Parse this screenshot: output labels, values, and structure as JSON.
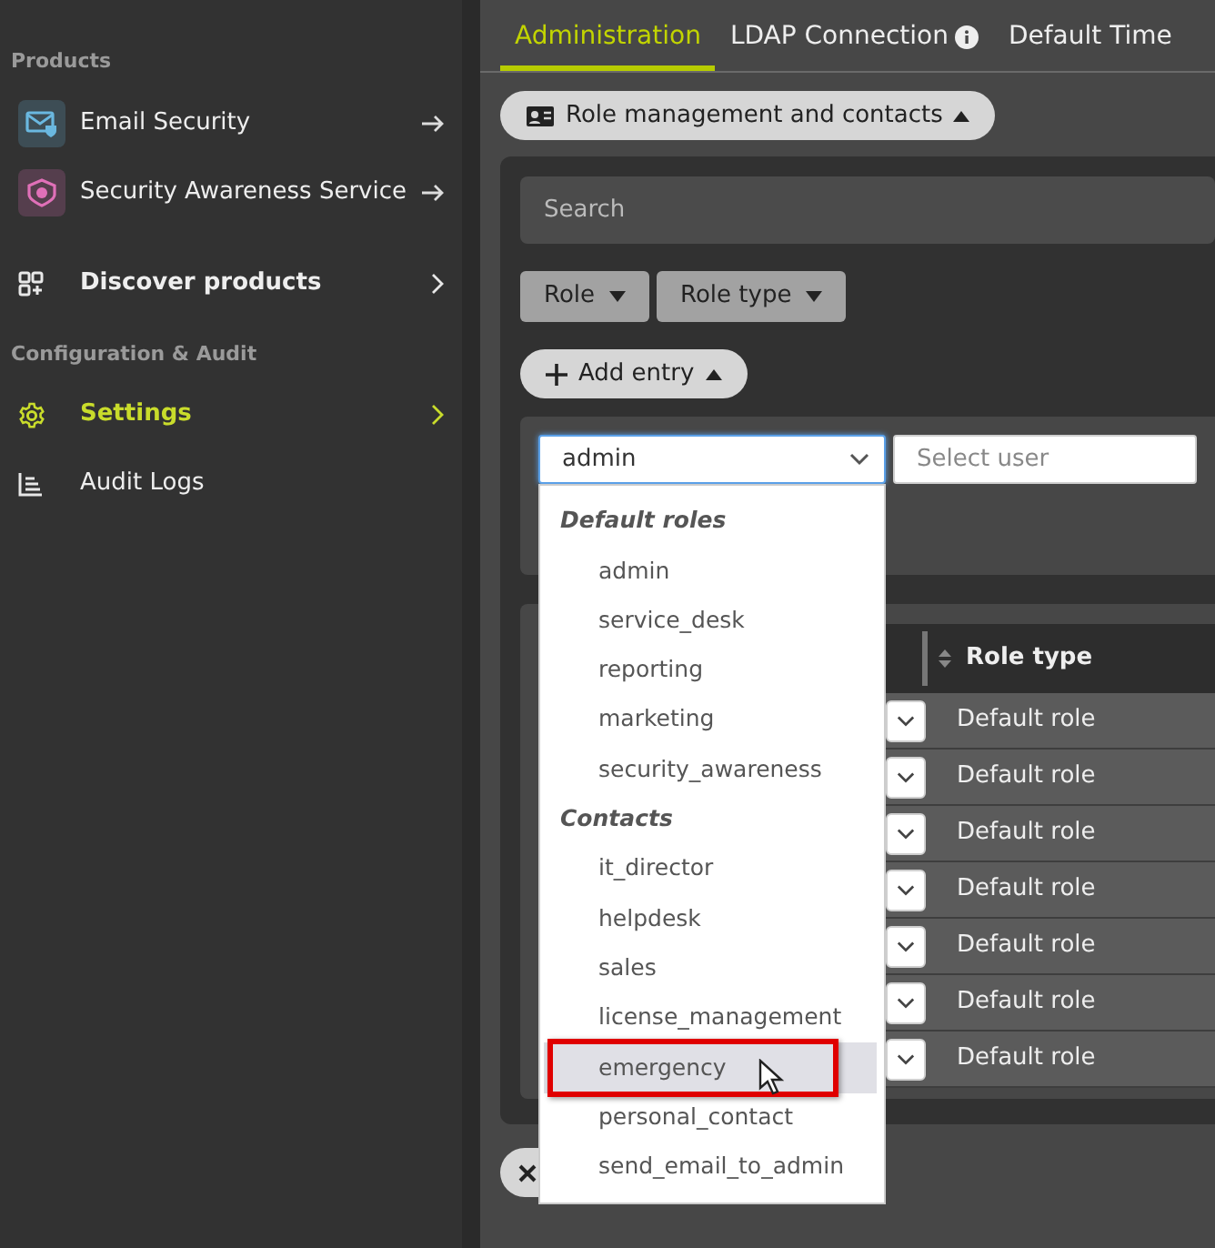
{
  "sidebar": {
    "sections": [
      {
        "title": "Products",
        "items": [
          {
            "label": "Email Security",
            "kind": "product",
            "color": "#6ab8e0",
            "selected": false
          },
          {
            "label": "Security Awareness Service",
            "kind": "product",
            "color": "#e070b8",
            "selected": false
          },
          {
            "label": "Discover products",
            "kind": "nav",
            "selected": false
          }
        ]
      },
      {
        "title": "Configuration & Audit",
        "items": [
          {
            "label": "Settings",
            "kind": "nav",
            "selected": true
          },
          {
            "label": "Audit Logs",
            "kind": "plain",
            "selected": false
          }
        ]
      }
    ]
  },
  "tabs": [
    {
      "label": "Administration",
      "selected": true,
      "info": false
    },
    {
      "label": "LDAP Connection",
      "selected": false,
      "info": true
    },
    {
      "label": "Default Time",
      "selected": false,
      "info": false
    }
  ],
  "section_toggle": {
    "label": "Role management and contacts",
    "expanded": true
  },
  "search": {
    "placeholder": "Search"
  },
  "filters": [
    {
      "label": "Role"
    },
    {
      "label": "Role type"
    }
  ],
  "add_entry": {
    "label": "Add entry",
    "expanded": true
  },
  "entry_form": {
    "role": {
      "value": "admin",
      "open": true
    },
    "user": {
      "placeholder": "Select user"
    }
  },
  "role_dropdown": [
    {
      "label": "Default roles",
      "options": [
        {
          "label": "admin",
          "highlighted": false
        },
        {
          "label": "service_desk",
          "highlighted": false
        },
        {
          "label": "reporting",
          "highlighted": false
        },
        {
          "label": "marketing",
          "highlighted": false
        },
        {
          "label": "security_awareness",
          "highlighted": false
        }
      ]
    },
    {
      "label": "Contacts",
      "options": [
        {
          "label": "it_director",
          "highlighted": false
        },
        {
          "label": "helpdesk",
          "highlighted": false
        },
        {
          "label": "sales",
          "highlighted": false
        },
        {
          "label": "license_management",
          "highlighted": false
        },
        {
          "label": "emergency",
          "highlighted": true
        },
        {
          "label": "personal_contact",
          "highlighted": false
        },
        {
          "label": "send_email_to_admin",
          "highlighted": false
        }
      ]
    }
  ],
  "table": {
    "columns": [
      "Role type"
    ],
    "rows": [
      {
        "role_type": "Default role"
      },
      {
        "role_type": "Default role"
      },
      {
        "role_type": "Default role"
      },
      {
        "role_type": "Default role"
      },
      {
        "role_type": "Default role"
      },
      {
        "role_type": "Default role"
      },
      {
        "role_type": "Default role"
      }
    ]
  }
}
